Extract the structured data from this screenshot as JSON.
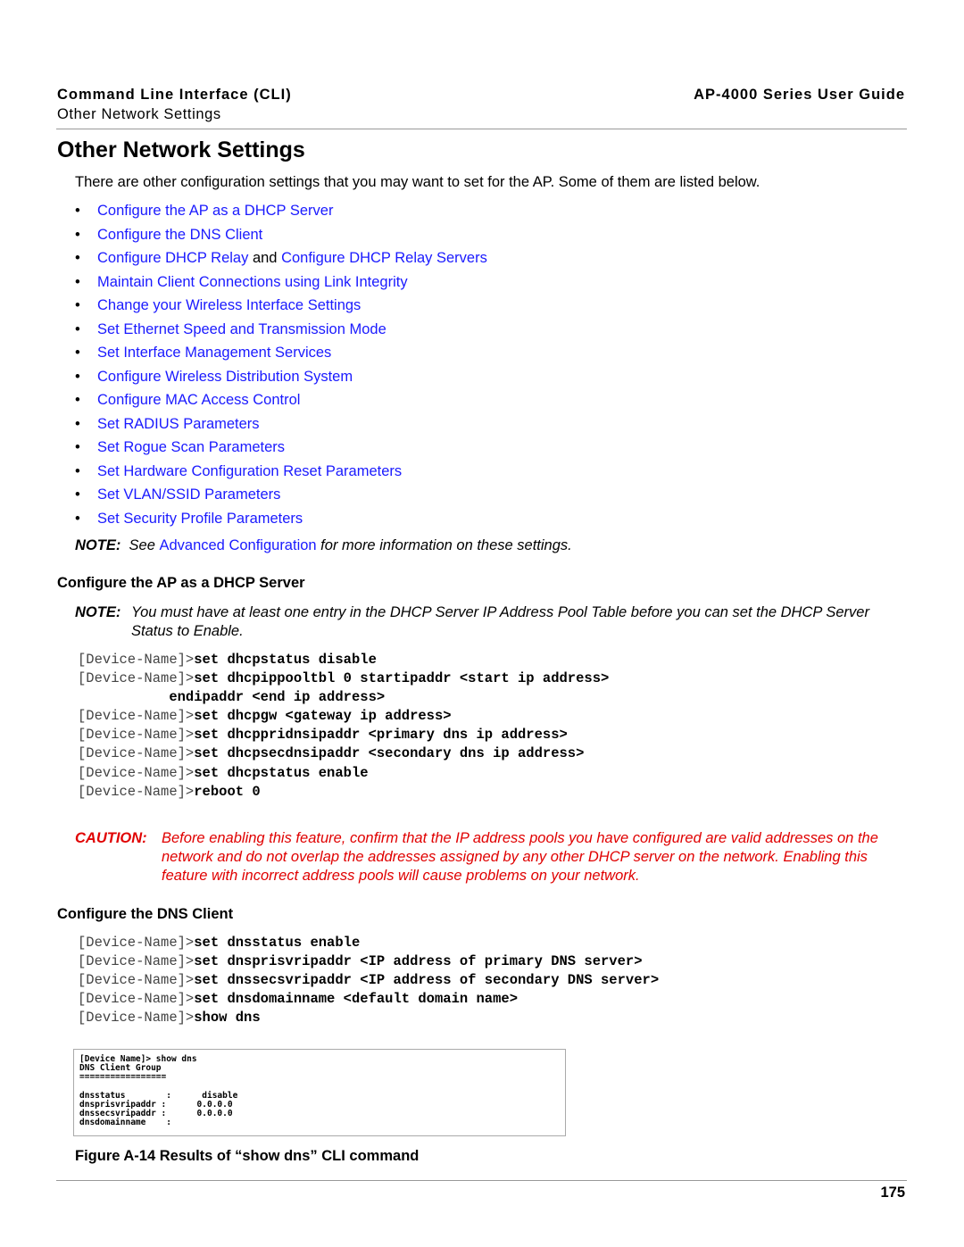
{
  "header": {
    "left_title": "Command Line Interface (CLI)",
    "left_subtitle": "Other Network Settings",
    "right_title": "AP-4000 Series User Guide"
  },
  "title": "Other Network Settings",
  "intro": "There are other configuration settings that you may want to set for the AP. Some of them are listed below.",
  "bullets": [
    [
      {
        "text": "Configure the AP as a DHCP Server",
        "link": true
      }
    ],
    [
      {
        "text": "Configure the DNS Client",
        "link": true
      }
    ],
    [
      {
        "text": "Configure DHCP Relay",
        "link": true
      },
      {
        "text": " and ",
        "link": false
      },
      {
        "text": "Configure DHCP Relay Servers",
        "link": true
      }
    ],
    [
      {
        "text": "Maintain Client Connections using Link Integrity",
        "link": true
      }
    ],
    [
      {
        "text": "Change your Wireless Interface Settings",
        "link": true
      }
    ],
    [
      {
        "text": "Set Ethernet Speed and Transmission Mode",
        "link": true
      }
    ],
    [
      {
        "text": "Set Interface Management Services",
        "link": true
      }
    ],
    [
      {
        "text": "Configure Wireless Distribution System",
        "link": true
      }
    ],
    [
      {
        "text": "Configure MAC Access Control",
        "link": true
      }
    ],
    [
      {
        "text": "Set RADIUS Parameters",
        "link": true
      }
    ],
    [
      {
        "text": "Set Rogue Scan Parameters",
        "link": true
      }
    ],
    [
      {
        "text": "Set Hardware Configuration Reset Parameters",
        "link": true
      }
    ],
    [
      {
        "text": "Set VLAN/SSID Parameters",
        "link": true
      }
    ],
    [
      {
        "text": "Set Security Profile Parameters",
        "link": true
      }
    ]
  ],
  "note1": {
    "label": "NOTE:",
    "pre": "See ",
    "link": "Advanced Configuration",
    "post": " for more information on these settings."
  },
  "dhcp": {
    "heading": "Configure the AP as a DHCP Server",
    "note_label": "NOTE:",
    "note": "You must have at least one entry in the DHCP Server IP Address Pool Table before you can set the DHCP Server Status to Enable.",
    "code": [
      {
        "prompt": "[Device-Name]>",
        "cmd": "set dhcpstatus disable"
      },
      {
        "prompt": "[Device-Name]>",
        "cmd": "set dhcpippooltbl 0 startipaddr <start ip address>"
      },
      {
        "prompt": "           ",
        "cmd": "endipaddr <end ip address>"
      },
      {
        "prompt": "[Device-Name]>",
        "cmd": "set dhcpgw <gateway ip address>"
      },
      {
        "prompt": "[Device-Name]>",
        "cmd": "set dhcppridnsipaddr <primary dns ip address>"
      },
      {
        "prompt": "[Device-Name]>",
        "cmd": "set dhcpsecdnsipaddr <secondary dns ip address>"
      },
      {
        "prompt": "[Device-Name]>",
        "cmd": "set dhcpstatus enable"
      },
      {
        "prompt": "[Device-Name]>",
        "cmd": "reboot 0"
      }
    ],
    "caution_label": "CAUTION:",
    "caution": "Before enabling this feature, confirm that the IP address pools you have configured are valid addresses on the network and do not overlap the addresses assigned by any other DHCP server on the network. Enabling this feature with incorrect address pools will cause problems on your network."
  },
  "dns": {
    "heading": "Configure the DNS Client",
    "code": [
      {
        "prompt": "[Device-Name]>",
        "cmd": "set dnsstatus enable"
      },
      {
        "prompt": "[Device-Name]>",
        "cmd": "set dnsprisvripaddr <IP address of primary DNS server>"
      },
      {
        "prompt": "[Device-Name]>",
        "cmd": "set dnssecsvripaddr <IP address of secondary DNS server>"
      },
      {
        "prompt": "[Device-Name]>",
        "cmd": "set dnsdomainname <default domain name>"
      },
      {
        "prompt": "[Device-Name]>",
        "cmd": "show dns"
      }
    ],
    "screenshot": "[Device Name]> show dns\nDNS Client Group\n=================\n\ndnsstatus        :      disable\ndnsprisvripaddr :      0.0.0.0\ndnssecsvripaddr :      0.0.0.0\ndnsdomainname    :",
    "caption": "Figure A-14 Results of “show dns” CLI command"
  },
  "page_number": "175",
  "colors": {
    "link": "#1a1aff",
    "caution": "#e00000"
  }
}
